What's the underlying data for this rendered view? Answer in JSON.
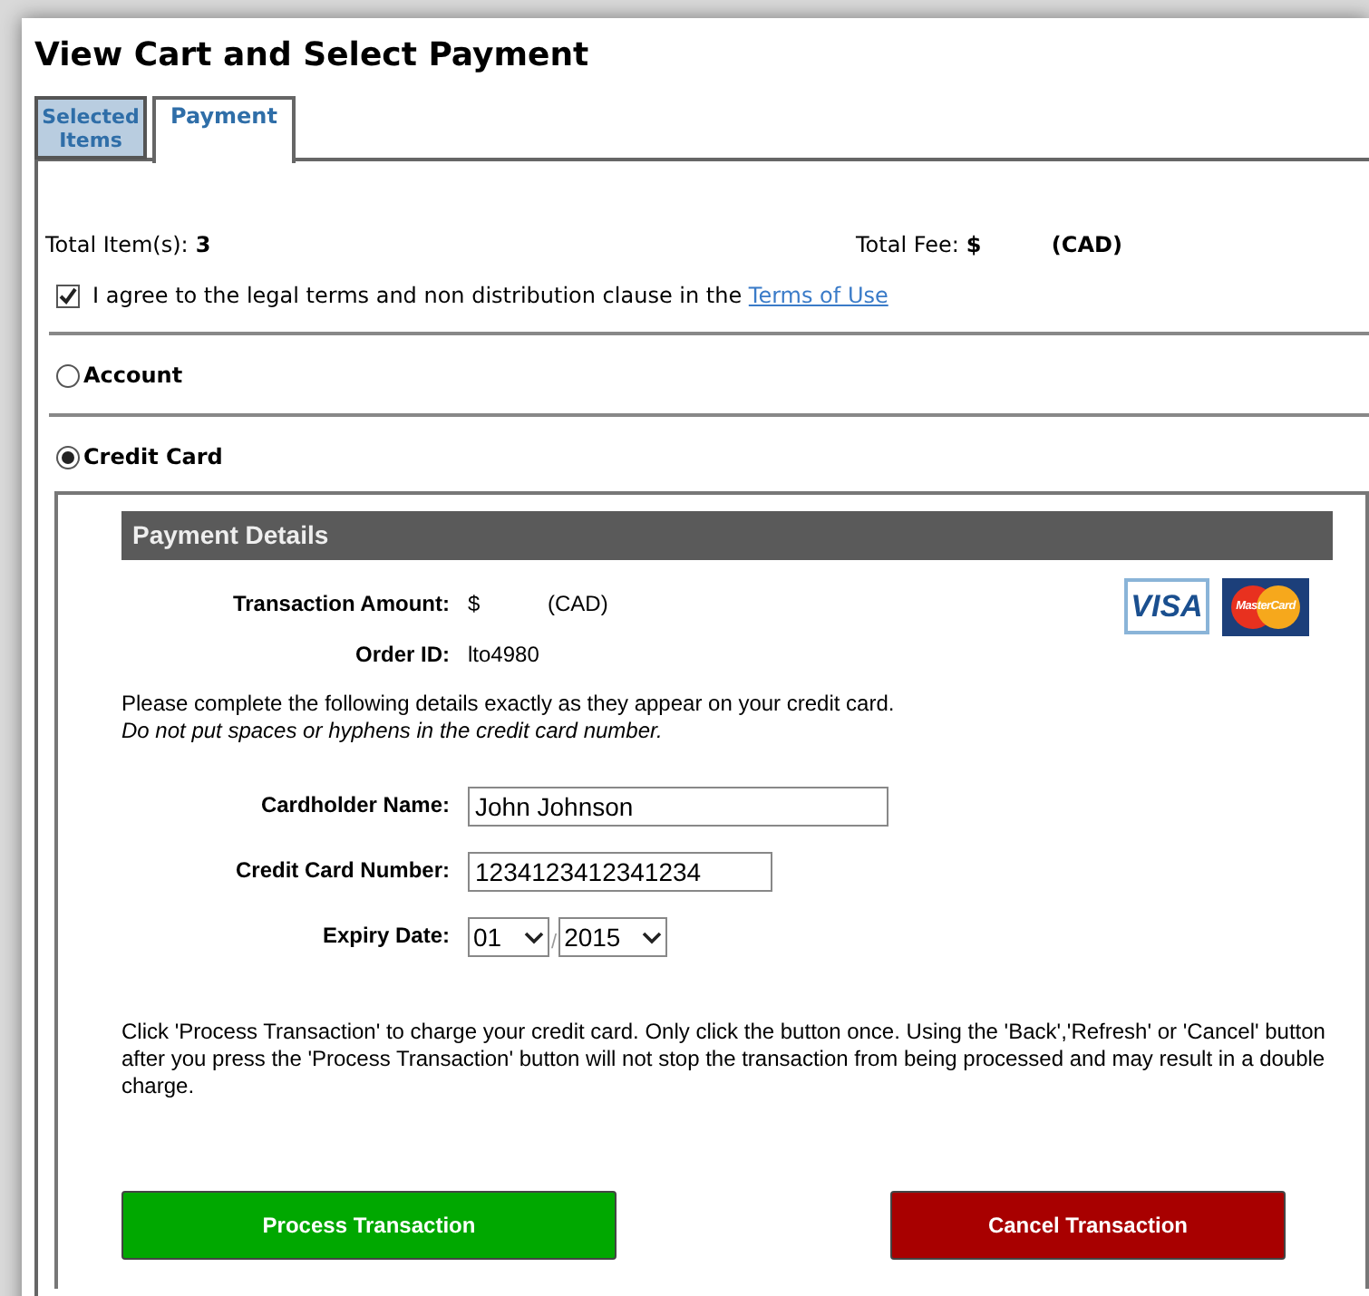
{
  "title": "View Cart and Select Payment",
  "tabs": [
    {
      "label": "Selected Items",
      "selected": false
    },
    {
      "label": "Payment",
      "selected": true
    }
  ],
  "totals": {
    "items_label": "Total Item(s):",
    "items_value": "3",
    "fee_label": "Total Fee:",
    "fee_value": "$",
    "fee_currency": "(CAD)"
  },
  "agreement": {
    "checked": true,
    "text": "I agree to the legal terms and non distribution clause in the",
    "link": "Terms of Use"
  },
  "payment_methods": [
    {
      "label": "Account",
      "selected": false
    },
    {
      "label": "Credit Card",
      "selected": true
    }
  ],
  "payment_details": {
    "header": "Payment Details",
    "summary": [
      {
        "label": "Transaction Amount:",
        "value": "$",
        "currency": "(CAD)"
      },
      {
        "label": "Order ID:",
        "value": "lto4980"
      }
    ],
    "cards": [
      "VISA",
      "MasterCard"
    ],
    "instructions": "Please complete the following details exactly as they appear on your credit card.",
    "note": "Do not put spaces or hyphens in the credit card number.",
    "form": [
      {
        "kind": "text",
        "label": "Cardholder Name:",
        "value": "John Johnson"
      },
      {
        "kind": "text",
        "label": "Credit Card Number:",
        "value": "1234123412341234"
      },
      {
        "kind": "expiry",
        "label": "Expiry Date:",
        "month": "01",
        "separator": "/",
        "year": "2015"
      }
    ],
    "notice": "Click 'Process Transaction' to charge your credit card. Only click the button once. Using the 'Back','Refresh' or 'Cancel' button after you press the 'Process Transaction' button will not stop the transaction from being processed and may result in a double charge.",
    "buttons": [
      {
        "label": "Process Transaction",
        "kind": "primary"
      },
      {
        "label": "Cancel Transaction",
        "kind": "danger"
      }
    ]
  }
}
